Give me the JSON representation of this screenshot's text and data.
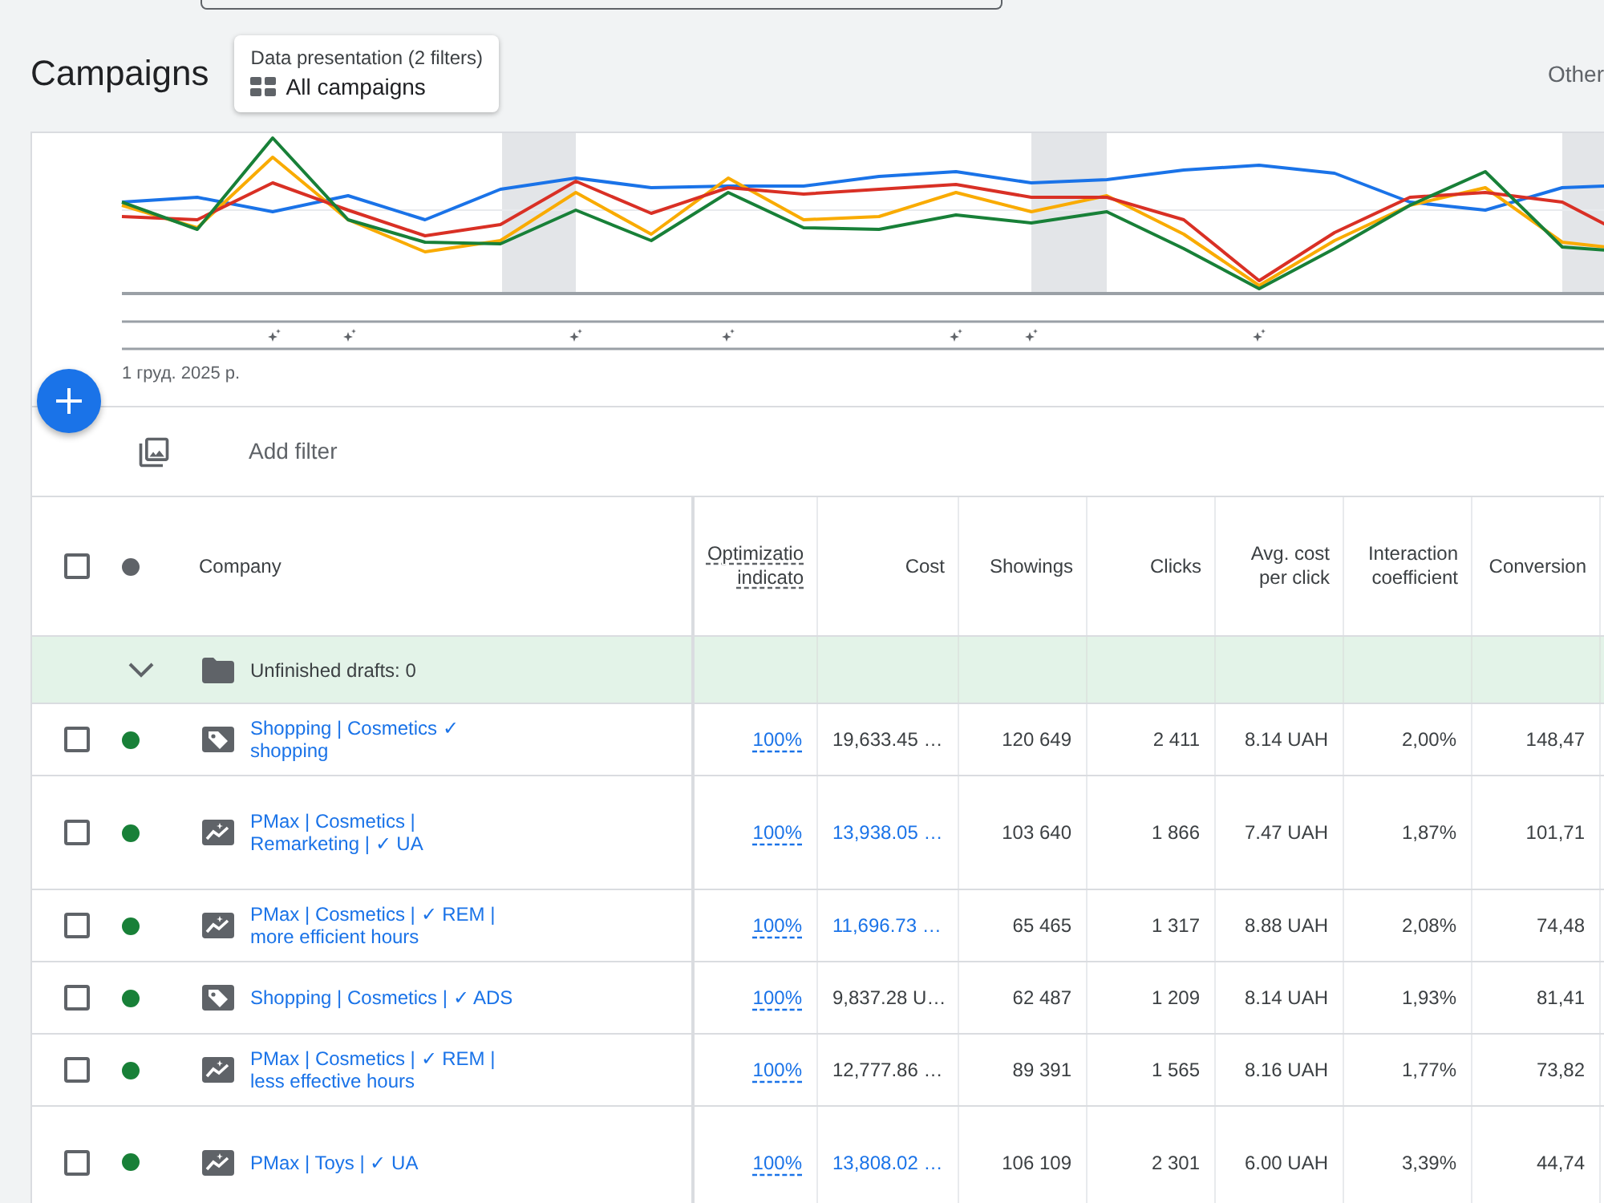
{
  "header": {
    "title": "Campaigns",
    "view_selector": {
      "caption": "Data presentation (2 filters)",
      "value": "All campaigns"
    },
    "other": "Other"
  },
  "chart": {
    "date_label": "1 груд. 2025 р."
  },
  "filter_bar": {
    "add_filter": "Add filter"
  },
  "table": {
    "select_all_checked": false,
    "columns": [
      "Company",
      "Optimizatio indicato",
      "Cost",
      "Showings",
      "Clicks",
      "Avg. cost per click",
      "Interaction coefficient",
      "Conversion"
    ],
    "drafts": {
      "label": "Unfinished drafts: 0"
    },
    "rows": [
      {
        "kind": "shopping",
        "checked": false,
        "name": "Shopping | Cosmetics ✓ shopping",
        "optimization": "100%",
        "cost": "19,633.45 …",
        "cost_link": false,
        "showings": "120 649",
        "clicks": "2 411",
        "avg_cpc": "8.14 UAH",
        "interaction_rate": "2,00%",
        "conversions": "148,47"
      },
      {
        "kind": "performance",
        "checked": false,
        "name": "PMax | Cosmetics | Remarketing | ✓ UA",
        "optimization": "100%",
        "cost": "13,938.05 …",
        "cost_link": true,
        "showings": "103 640",
        "clicks": "1 866",
        "avg_cpc": "7.47 UAH",
        "interaction_rate": "1,87%",
        "conversions": "101,71"
      },
      {
        "kind": "performance",
        "checked": false,
        "name": "PMax | Cosmetics | ✓ REM | more efficient hours",
        "optimization": "100%",
        "cost": "11,696.73 …",
        "cost_link": true,
        "showings": "65 465",
        "clicks": "1 317",
        "avg_cpc": "8.88 UAH",
        "interaction_rate": "2,08%",
        "conversions": "74,48"
      },
      {
        "kind": "shopping",
        "checked": false,
        "name": "Shopping | Cosmetics | ✓ ADS",
        "optimization": "100%",
        "cost": "9,837.28 U…",
        "cost_link": false,
        "showings": "62 487",
        "clicks": "1 209",
        "avg_cpc": "8.14 UAH",
        "interaction_rate": "1,93%",
        "conversions": "81,41"
      },
      {
        "kind": "performance",
        "checked": false,
        "name": "PMax | Cosmetics | ✓ REM | less effective hours",
        "optimization": "100%",
        "cost": "12,777.86 …",
        "cost_link": false,
        "showings": "89 391",
        "clicks": "1 565",
        "avg_cpc": "8.16 UAH",
        "interaction_rate": "1,77%",
        "conversions": "73,82"
      },
      {
        "kind": "performance",
        "checked": false,
        "name": "PMax | Toys | ✓ UA",
        "optimization": "100%",
        "cost": "13,808.02 …",
        "cost_link": true,
        "showings": "106 109",
        "clicks": "2 301",
        "avg_cpc": "6.00 UAH",
        "interaction_rate": "3,39%",
        "conversions": "44,74"
      }
    ]
  }
}
